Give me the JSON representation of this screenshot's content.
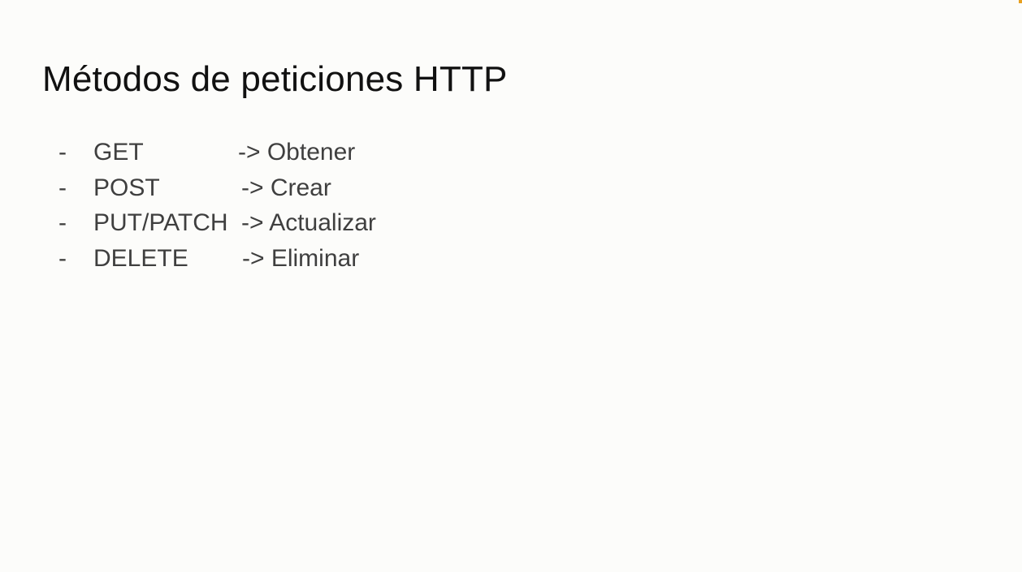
{
  "slide": {
    "title": "Métodos de peticiones HTTP",
    "items": [
      {
        "bullet": "-",
        "method": "GET",
        "action": "-> Obtener"
      },
      {
        "bullet": "-",
        "method": "POST",
        "action": "-> Crear"
      },
      {
        "bullet": "-",
        "method": "PUT/PATCH",
        "action": "-> Actualizar"
      },
      {
        "bullet": "-",
        "method": "DELETE",
        "action": "-> Eliminar"
      }
    ]
  },
  "colors": {
    "background": "#fcfcfa",
    "title": "#111111",
    "body_text": "#3f3f3f",
    "corner_accent": "#e8a020"
  }
}
